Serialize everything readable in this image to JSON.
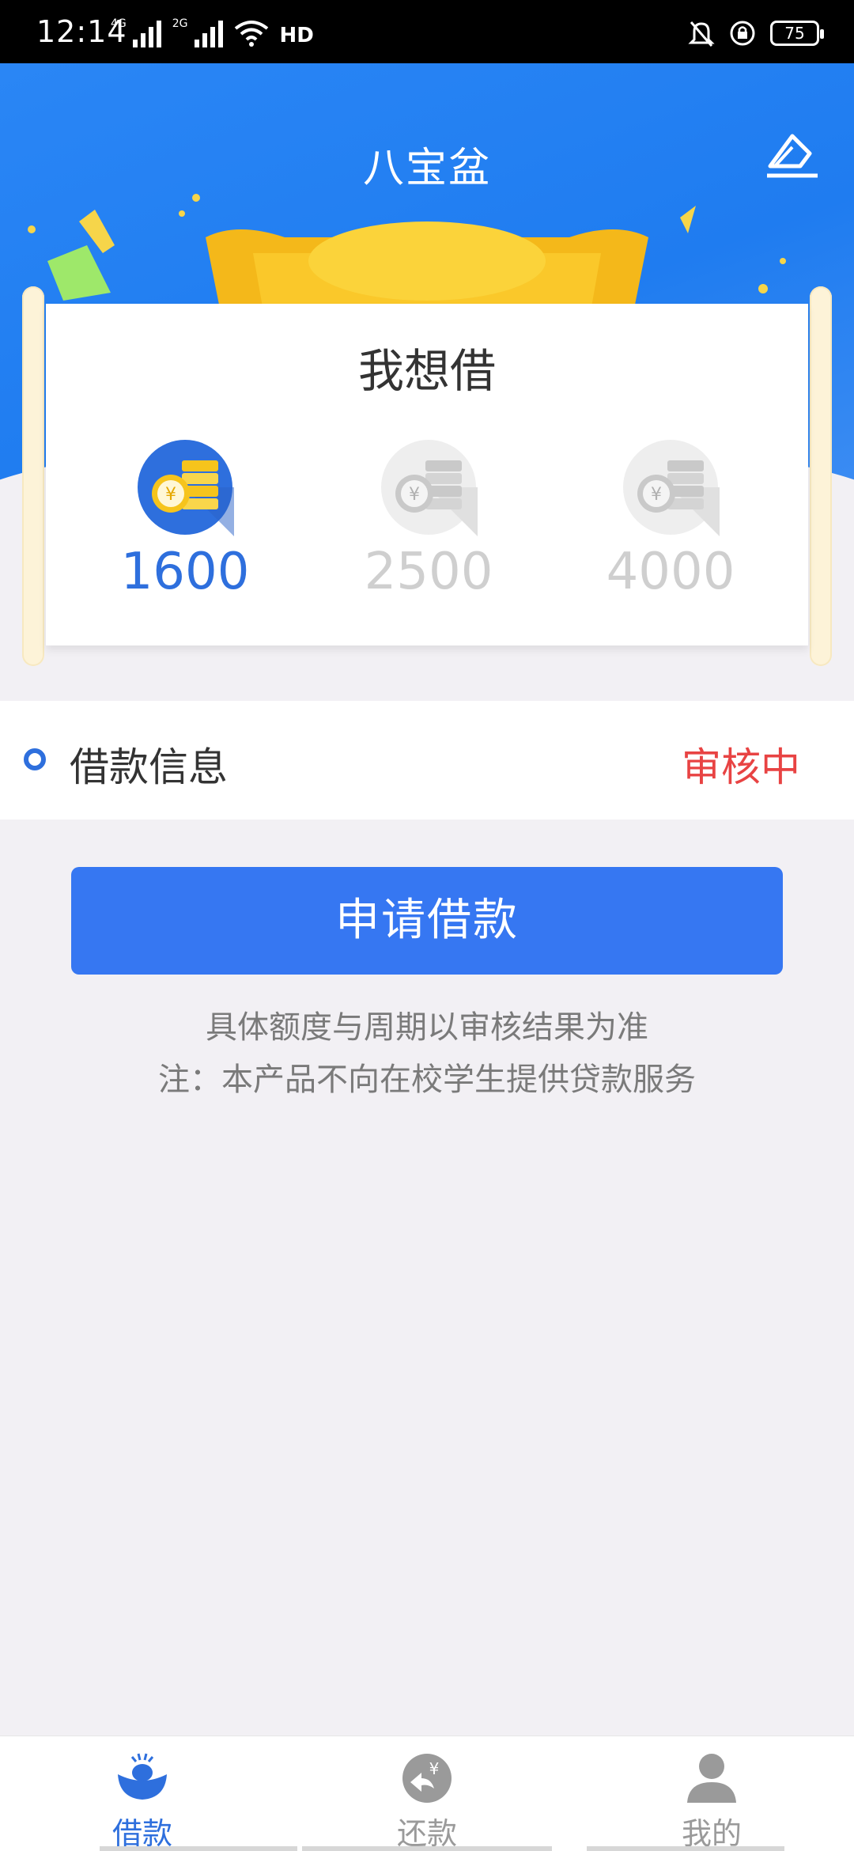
{
  "status_bar": {
    "time": "12:14",
    "network_1": "4G",
    "network_2": "2G",
    "hd_label": "HD",
    "battery": "75",
    "icons": [
      "signal-icon",
      "wifi-icon",
      "hd-icon",
      "mute-icon",
      "lock-rotation-icon",
      "battery-icon"
    ]
  },
  "header": {
    "title": "八宝盆",
    "edit_icon": "edit-note-icon"
  },
  "card": {
    "title": "我想借",
    "amounts": [
      {
        "value": "1600",
        "selected": true
      },
      {
        "value": "2500",
        "selected": false
      },
      {
        "value": "4000",
        "selected": false
      }
    ]
  },
  "loan_info": {
    "label": "借款信息",
    "status": "审核中"
  },
  "apply_button": {
    "label": "申请借款"
  },
  "notes": {
    "line1": "具体额度与周期以审核结果为准",
    "line2": "注：本产品不向在校学生提供贷款服务"
  },
  "bottom_nav": {
    "items": [
      {
        "label": "借款",
        "icon": "ingot-icon",
        "active": true
      },
      {
        "label": "还款",
        "icon": "repay-icon",
        "active": false
      },
      {
        "label": "我的",
        "icon": "user-icon",
        "active": false
      }
    ]
  },
  "colors": {
    "primary": "#3677f2",
    "header_blue": "#1f7cf0",
    "status_red": "#e84343",
    "inactive_gray": "#cfcfcf",
    "gold": "#f8c31b"
  }
}
